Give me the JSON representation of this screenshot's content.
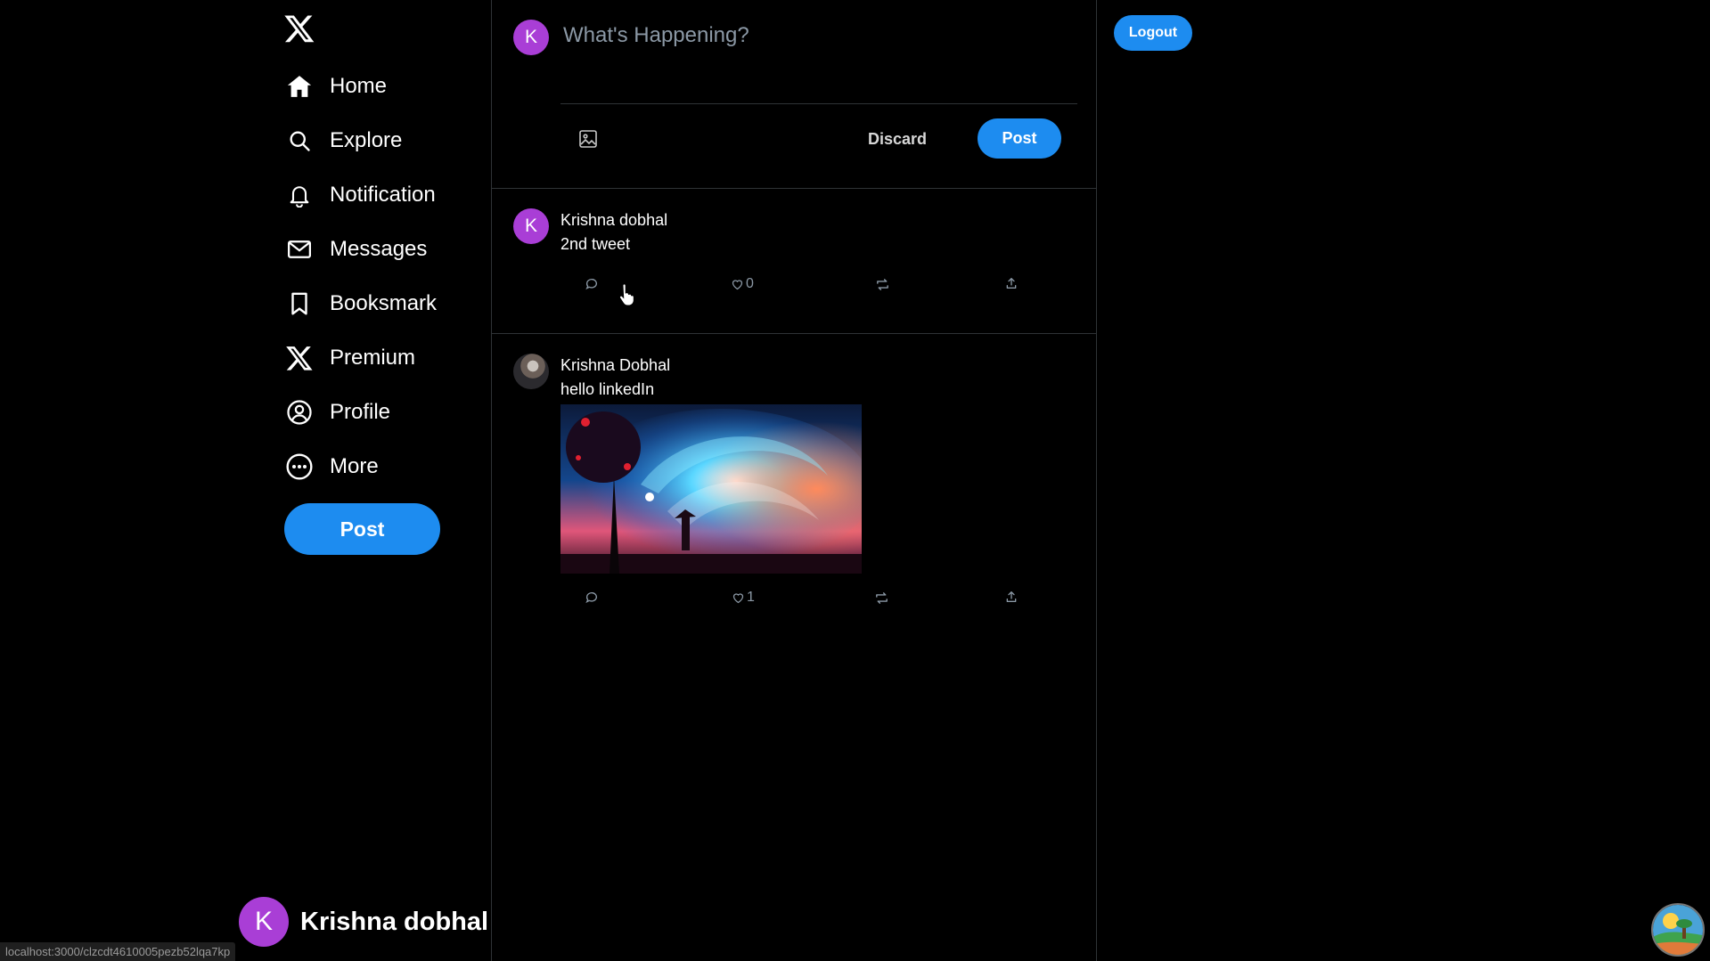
{
  "sidebar": {
    "logo": "x-logo",
    "items": [
      {
        "label": "Home",
        "icon": "home-icon"
      },
      {
        "label": "Explore",
        "icon": "search-icon"
      },
      {
        "label": "Notification",
        "icon": "bell-icon"
      },
      {
        "label": "Messages",
        "icon": "mail-icon"
      },
      {
        "label": "Booksmark",
        "icon": "bookmark-icon"
      },
      {
        "label": "Premium",
        "icon": "x-icon"
      },
      {
        "label": "Profile",
        "icon": "profile-icon"
      },
      {
        "label": "More",
        "icon": "more-icon"
      }
    ],
    "post_label": "Post",
    "account": {
      "initial": "K",
      "name": "Krishna dobhal"
    }
  },
  "composer": {
    "avatar_initial": "K",
    "placeholder": "What's Happening?",
    "discard_label": "Discard",
    "post_label": "Post"
  },
  "tweets": [
    {
      "avatar_initial": "K",
      "author": "Krishna dobhal",
      "text": "2nd tweet",
      "likes": "0"
    },
    {
      "author": "Krishna Dobhal",
      "text": "hello linkedIn",
      "likes": "1"
    }
  ],
  "header": {
    "logout_label": "Logout"
  },
  "statusbar": {
    "url": "localhost:3000/clzcdt4610005pezb52lqa7kp"
  },
  "colors": {
    "accent": "#1d8cf0",
    "avatar": "#a93ed6",
    "background": "#000000",
    "border": "#2f3336",
    "muted": "#8b98a5"
  }
}
